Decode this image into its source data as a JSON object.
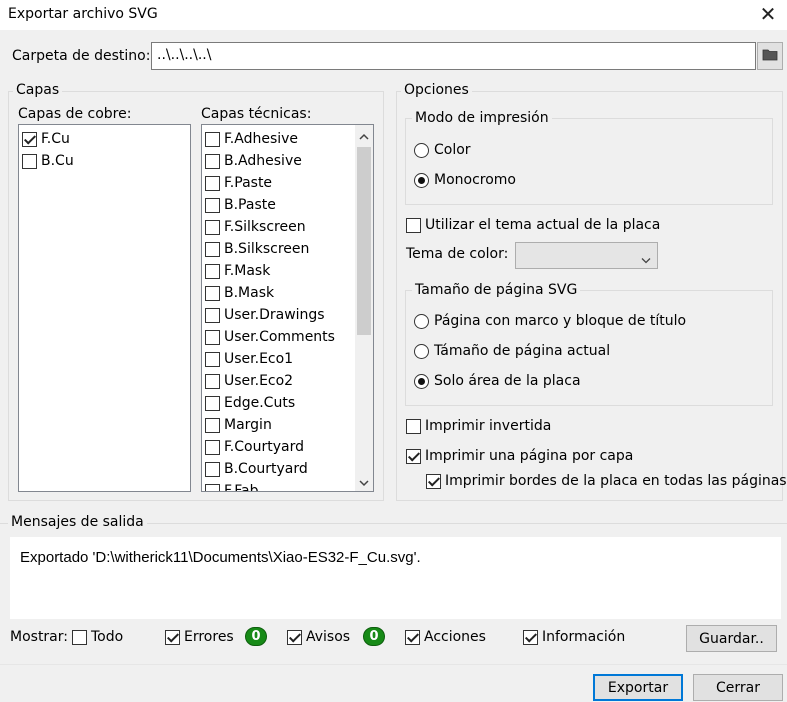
{
  "window": {
    "title": "Exportar archivo SVG",
    "close_glyph": "✕"
  },
  "destination": {
    "label": "Carpeta de destino:",
    "value": "..\\..\\..\\..\\",
    "browse_icon": "folder-icon"
  },
  "layers": {
    "title": "Capas",
    "copper": {
      "label": "Capas de cobre:",
      "items": [
        {
          "label": "F.Cu",
          "checked": true
        },
        {
          "label": "B.Cu",
          "checked": false
        }
      ]
    },
    "technical": {
      "label": "Capas técnicas:",
      "items": [
        {
          "label": "F.Adhesive",
          "checked": false
        },
        {
          "label": "B.Adhesive",
          "checked": false
        },
        {
          "label": "F.Paste",
          "checked": false
        },
        {
          "label": "B.Paste",
          "checked": false
        },
        {
          "label": "F.Silkscreen",
          "checked": false
        },
        {
          "label": "B.Silkscreen",
          "checked": false
        },
        {
          "label": "F.Mask",
          "checked": false
        },
        {
          "label": "B.Mask",
          "checked": false
        },
        {
          "label": "User.Drawings",
          "checked": false
        },
        {
          "label": "User.Comments",
          "checked": false
        },
        {
          "label": "User.Eco1",
          "checked": false
        },
        {
          "label": "User.Eco2",
          "checked": false
        },
        {
          "label": "Edge.Cuts",
          "checked": false
        },
        {
          "label": "Margin",
          "checked": false
        },
        {
          "label": "F.Courtyard",
          "checked": false
        },
        {
          "label": "B.Courtyard",
          "checked": false
        },
        {
          "label": "F.Fab",
          "checked": false
        }
      ]
    }
  },
  "options": {
    "title": "Opciones",
    "print_mode": {
      "title": "Modo de impresión",
      "color_label": "Color",
      "mono_label": "Monocromo",
      "selected": "mono"
    },
    "use_board_theme": {
      "label": "Utilizar el tema actual de la placa",
      "checked": false
    },
    "color_theme": {
      "label": "Tema de color:",
      "value": ""
    },
    "page_size": {
      "title": "Tamaño de página SVG",
      "opt1": "Página con marco y bloque de título",
      "opt2": "Támaño de página actual",
      "opt3": "Solo área de la placa",
      "selected": "opt3"
    },
    "mirror": {
      "label": "Imprimir invertida",
      "checked": false
    },
    "one_page_per_layer": {
      "label": "Imprimir una página por capa",
      "checked": true
    },
    "board_edges": {
      "label": "Imprimir bordes de la placa en todas las páginas",
      "checked": true
    }
  },
  "messages": {
    "title": "Mensajes de salida",
    "text": "Exportado 'D:\\witherick11\\Documents\\Xiao-ES32-F_Cu.svg'.",
    "show_label": "Mostrar:",
    "all_label": "Todo",
    "errors_label": "Errores",
    "errors_count": "0",
    "warnings_label": "Avisos",
    "warnings_count": "0",
    "actions_label": "Acciones",
    "info_label": "Información",
    "save_label": "Guardar.."
  },
  "footer": {
    "export_label": "Exportar",
    "close_label": "Cerrar"
  },
  "colors": {
    "accent": "#0078d7",
    "badge": "#178a17"
  }
}
